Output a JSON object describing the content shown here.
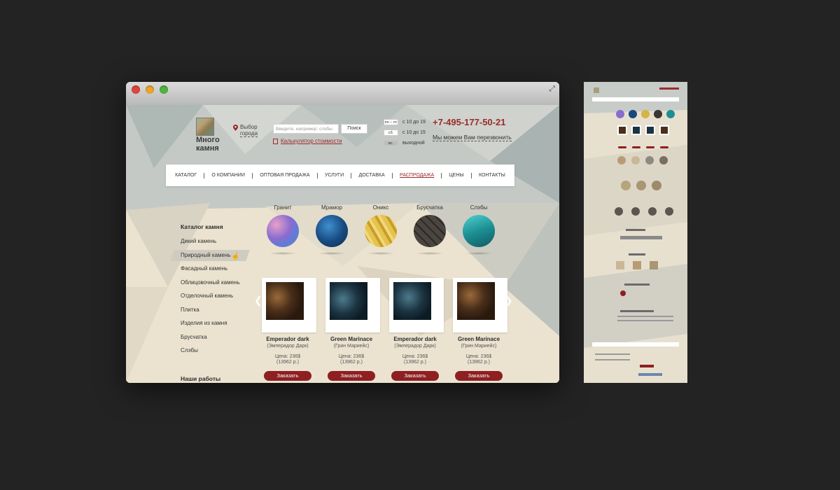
{
  "header": {
    "logo_text_1": "Много",
    "logo_text_2": "камня",
    "city_line1": "Выбор",
    "city_line2": "города",
    "search_placeholder": "Введите, например: слэбы",
    "search_button": "Поиск",
    "calculator": "Калькулятор стоимости",
    "hours": [
      {
        "day": "пн – пт",
        "time": "с 10 до 19"
      },
      {
        "day": "сб.",
        "time": "с 10 до 15"
      },
      {
        "day": "вс.",
        "time": "выходной"
      }
    ],
    "phone": "+7-495-177-50-21",
    "callback": "Мы можем Вам перезвонить"
  },
  "nav": [
    "КАТАЛОГ",
    "О КОМПАНИИ",
    "ОПТОВАЯ ПРОДАЖА",
    "УСЛУГИ",
    "ДОСТАВКА",
    "РАСПРОДАЖА",
    "ЦЕНЫ",
    "КОНТАКТЫ"
  ],
  "nav_active_index": 5,
  "sidebar": {
    "title": "Каталог камня",
    "items": [
      "Дикий камень",
      "Природный камень",
      "Фасадный камень",
      "Облицовочный камень",
      "Отделочный камень",
      "Плитка",
      "Изделия из камня",
      "Брусчатка",
      "Слэбы"
    ],
    "active_index": 1,
    "works_title": "Наши работы"
  },
  "categories": [
    "Гранит",
    "Мрамор",
    "Оникс",
    "Брусчатка",
    "Слэбы"
  ],
  "products": [
    {
      "name": "Emperador dark",
      "sub": "(Эмперадор Дарк)",
      "price": "Цена: 236$",
      "price2": "(13962 р.)",
      "order": "Заказать",
      "tone": "brown"
    },
    {
      "name": "Green Marinace",
      "sub": "(Грин Мариейс)",
      "price": "Цена: 236$",
      "price2": "(13962 р.)",
      "order": "Заказать",
      "tone": "blue"
    },
    {
      "name": "Emperador dark",
      "sub": "(Эмперадор Дарк)",
      "price": "Цена: 236$",
      "price2": "(13962 р.)",
      "order": "Заказать",
      "tone": "blue"
    },
    {
      "name": "Green Marinace",
      "sub": "(Грин Мариейс)",
      "price": "Цена: 236$",
      "price2": "(13962 р.)",
      "order": "Заказать",
      "tone": "brown"
    }
  ],
  "colors": {
    "accent": "#9b2b2b",
    "button": "#8e1f22",
    "backdrop": "#232323"
  }
}
